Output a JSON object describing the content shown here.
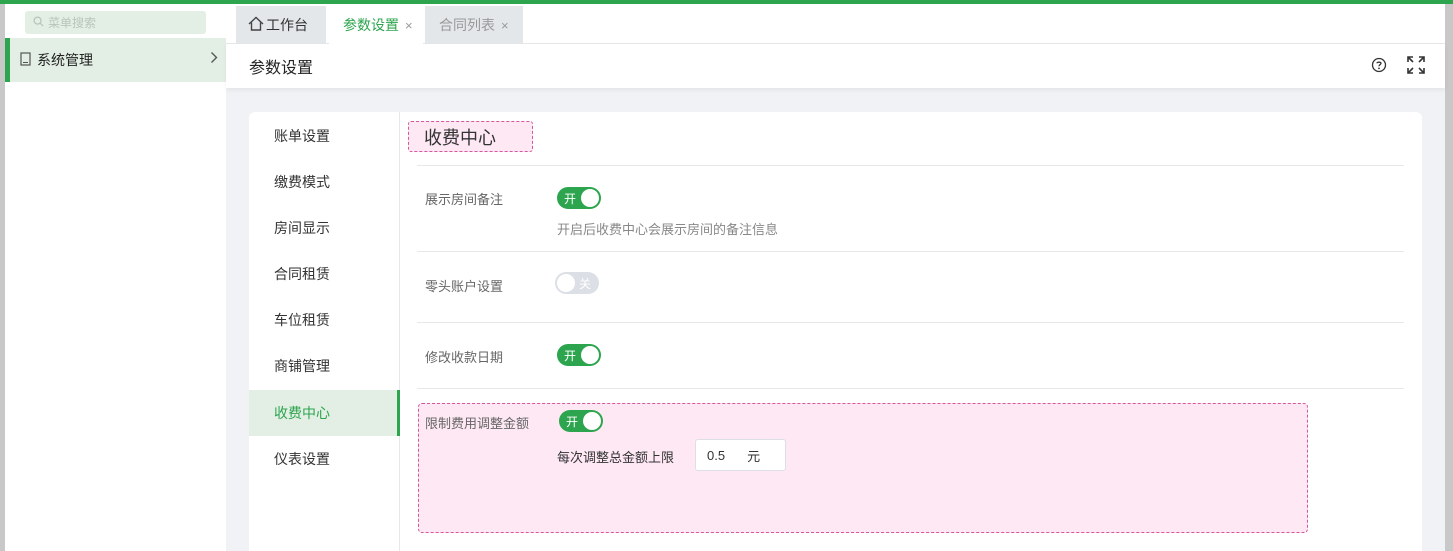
{
  "sidebar": {
    "search_placeholder": "菜单搜索",
    "menu": [
      {
        "label": "系统管理"
      }
    ]
  },
  "tabs": [
    {
      "label": "工作台"
    },
    {
      "label": "参数设置"
    },
    {
      "label": "合同列表"
    }
  ],
  "tab_close_glyph": "×",
  "page": {
    "title": "参数设置"
  },
  "settings_nav": [
    {
      "label": "账单设置"
    },
    {
      "label": "缴费模式"
    },
    {
      "label": "房间显示"
    },
    {
      "label": "合同租赁"
    },
    {
      "label": "车位租赁"
    },
    {
      "label": "商铺管理"
    },
    {
      "label": "收费中心"
    },
    {
      "label": "仪表设置"
    }
  ],
  "active_nav": "收费中心",
  "section": {
    "title": "收费中心",
    "rows": [
      {
        "label": "展示房间备注",
        "state": "开",
        "description": "开启后收费中心会展示房间的备注信息"
      },
      {
        "label": "零头账户设置",
        "state": "关"
      },
      {
        "label": "修改收款日期",
        "state": "开"
      },
      {
        "label": "限制费用调整金额",
        "state": "开"
      }
    ],
    "limit": {
      "label": "每次调整总金额上限",
      "value": "0.5",
      "unit": "元"
    }
  },
  "colors": {
    "accent": "#2da44e",
    "highlight_border": "#d5579e",
    "highlight_bg": "#fde8f3"
  }
}
